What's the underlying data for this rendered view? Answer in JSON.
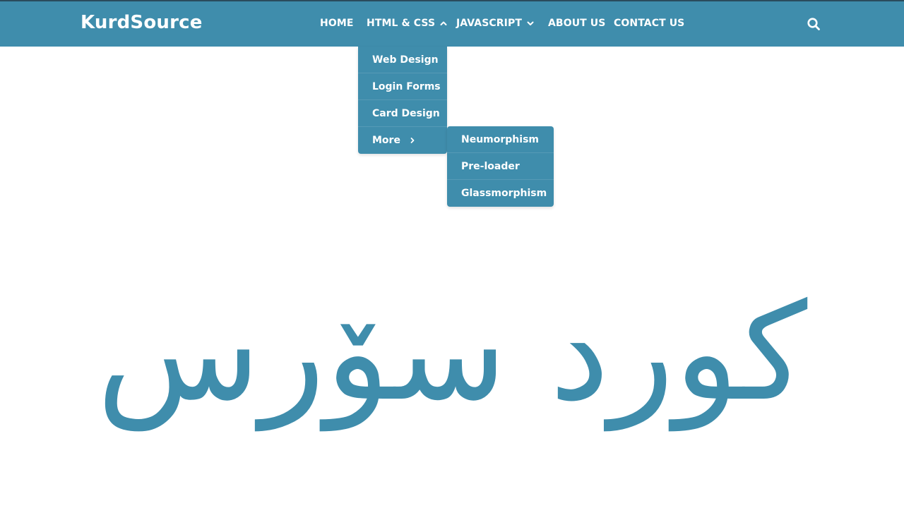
{
  "brand": {
    "name": "KurdSource"
  },
  "nav": {
    "items": [
      {
        "label": "HOME"
      },
      {
        "label": "HTML & CSS",
        "dropdown": "chevron-up-icon"
      },
      {
        "label": "JAVASCRIPT",
        "dropdown": "chevron-down-icon"
      },
      {
        "label": "ABOUT US"
      },
      {
        "label": "CONTACT US"
      }
    ],
    "search_icon": "search-icon"
  },
  "dropdown": {
    "items": [
      {
        "label": "Web Design"
      },
      {
        "label": "Login Forms"
      },
      {
        "label": "Card Design"
      },
      {
        "label": "More",
        "icon": "chevron-right-icon"
      }
    ]
  },
  "submenu": {
    "items": [
      {
        "label": "Neumorphism"
      },
      {
        "label": "Pre-loader"
      },
      {
        "label": "Glassmorphism"
      }
    ]
  },
  "hero": {
    "text": "کورد سۆرس"
  },
  "colors": {
    "accent": "#3f8dac",
    "text_on_accent": "#ffffff",
    "background": "#ffffff"
  }
}
